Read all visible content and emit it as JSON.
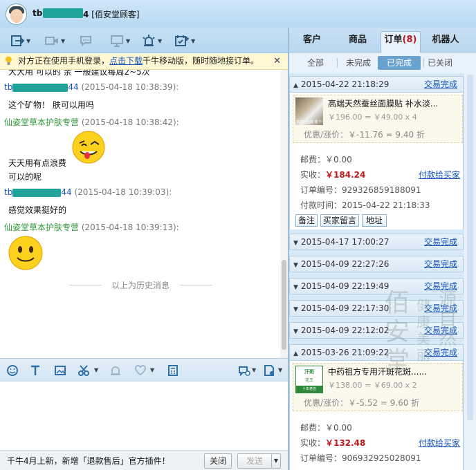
{
  "title": {
    "name_prefix": "tb",
    "name_suffix": "4",
    "role": "[佰安堂顾客]"
  },
  "notice": {
    "pre": "对方正在使用手机登录，",
    "link": "点击下载",
    "post": "千牛移动版，随时随地接订单。",
    "close": "✕"
  },
  "chat": {
    "cut_line": "大大用  可以的 亲   一般建议每周2~5次",
    "messages": [
      {
        "who_prefix": "tb",
        "who_suffix": "44",
        "time": "(2015-04-18 10:38:39):",
        "text": "这个矿物！ 肤可以用吗"
      },
      {
        "who": "仙姿堂草本护肤专营",
        "time": "(2015-04-18 10:38:42):",
        "text1": "天天用有点浪费",
        "text2": "可以的呢"
      },
      {
        "who_prefix": "tb",
        "who_suffix": "44",
        "time": "(2015-04-18 10:39:03):",
        "text": "感觉效果挺好的"
      },
      {
        "who": "仙姿堂草本护肤专营",
        "time": "(2015-04-18 10:39:13):"
      }
    ],
    "history": "以上为历史消息"
  },
  "bottom": {
    "promo": "千牛4月上新，新增「退款售后」官方插件！",
    "close": "关闭",
    "send": "发送"
  },
  "right": {
    "tabs": [
      {
        "label": "客户"
      },
      {
        "label": "商品"
      },
      {
        "label": "订单",
        "count": "(8)"
      },
      {
        "label": "机器人"
      }
    ],
    "subtabs": [
      {
        "label": "全部"
      },
      {
        "label": "未完成"
      },
      {
        "label": "已完成"
      },
      {
        "label": "已关闭"
      }
    ],
    "orders": [
      {
        "time": "2015-04-22 21:18:29",
        "status": "交易完成",
        "product": "高端天然蚕丝面膜贴    补水淡...",
        "price": "￥196.00 = ￥49.00 x 4",
        "discount": "优惠/涨价：￥-11.76 = 9.40 折",
        "postage_k": "邮费：",
        "postage_v": "￥0.00",
        "paid_k": "实收：",
        "paid_v": "￥184.24",
        "pay_link": "付款给买家",
        "no_k": "订单编号：",
        "no_v": "929326859188091",
        "paytime_k": "付款时间：",
        "paytime_v": "2015-04-22 21:18:33",
        "btns": [
          "备注",
          "买家留言",
          "地址"
        ]
      },
      {
        "time": "2015-04-17 17:00:27",
        "status": "交易完成"
      },
      {
        "time": "2015-04-09 22:27:26",
        "status": "交易完成"
      },
      {
        "time": "2015-04-09 22:19:49",
        "status": "交易完成"
      },
      {
        "time": "2015-04-09 22:17:30",
        "status": "交易完成"
      },
      {
        "time": "2015-04-09 22:12:02",
        "status": "交易完成"
      },
      {
        "time": "2015-03-26 21:09:22",
        "status": "交易完成",
        "product": "中药祖方专用汗斑花斑......",
        "price": "￥138.00 = ￥69.00 x 2",
        "discount": "优惠/涨价：￥-5.52 = 9.60 折",
        "postage_k": "邮费：",
        "postage_v": "￥0.00",
        "paid_k": "实收：",
        "paid_v": "￥132.48",
        "pay_link": "付款给买家",
        "no_k": "订单编号：",
        "no_v": "906932925028091"
      }
    ],
    "thumb1_text": "高端好面膜 量下都在好",
    "thumb2_text": [
      "汗斑",
      "花王",
      "十年老店"
    ]
  },
  "watermark": {
    "big": "佰安堂",
    "c2": "健康美丽",
    "c3": "源自然"
  },
  "colors": {
    "link": "#1652b8",
    "shop_name": "#2f9a3a",
    "paid": "#c0171c",
    "mask": "#1fa39b"
  }
}
